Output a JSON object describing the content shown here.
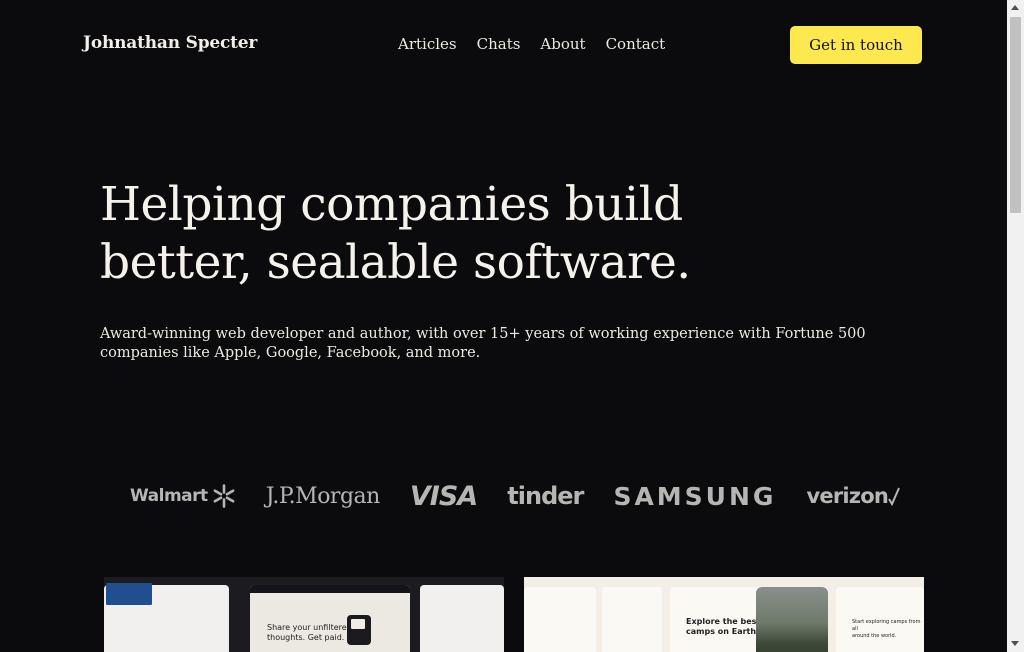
{
  "header": {
    "brand": "Johnathan Specter",
    "nav": [
      "Articles",
      "Chats",
      "About",
      "Contact"
    ],
    "cta_label": "Get in touch"
  },
  "hero": {
    "title_line1": "Helping companies build",
    "title_line2": "better, sealable software.",
    "subtitle_line1": "Award-winning web developer and author, with over 15+ years of working experience with Fortune 500",
    "subtitle_line2": "companies like Apple, Google, Facebook, and more."
  },
  "logos": {
    "walmart": "Walmart",
    "jpmorgan": "J.P.Morgan",
    "visa": "VISA",
    "tinder": "tinder",
    "samsung": "SAMSUNG",
    "verizon": "verizon",
    "color": "#b7b5b3"
  },
  "projects": {
    "card1": {
      "headline_line1": "Share your unfiltered",
      "headline_line2": "thoughts. Get paid."
    },
    "card2": {
      "headline_line1": "Explore the best",
      "headline_line2": "camps on Earth.",
      "side_text_line1": "Start exploring camps from all",
      "side_text_line2": "around the world."
    }
  },
  "colors": {
    "background": "#0b0a0c",
    "accent": "#fde84f",
    "text": "#f2efe9"
  }
}
